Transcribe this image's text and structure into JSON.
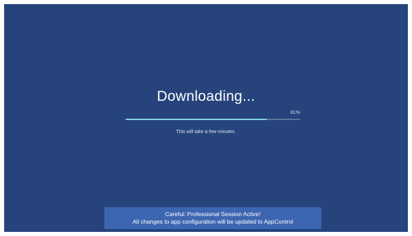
{
  "title": "Downloading...",
  "progress": {
    "percent": 81,
    "label": "81%"
  },
  "subtitle": "This will take a few minutes.",
  "banner": {
    "line1": "Careful: Professional Session Active!",
    "line2": "All changes to app configuration will be updated to AppControl"
  },
  "colors": {
    "background": "#26437b",
    "progress_fill": "#7fd3df",
    "progress_track": "#5e7498",
    "banner": "#3d66b1"
  }
}
